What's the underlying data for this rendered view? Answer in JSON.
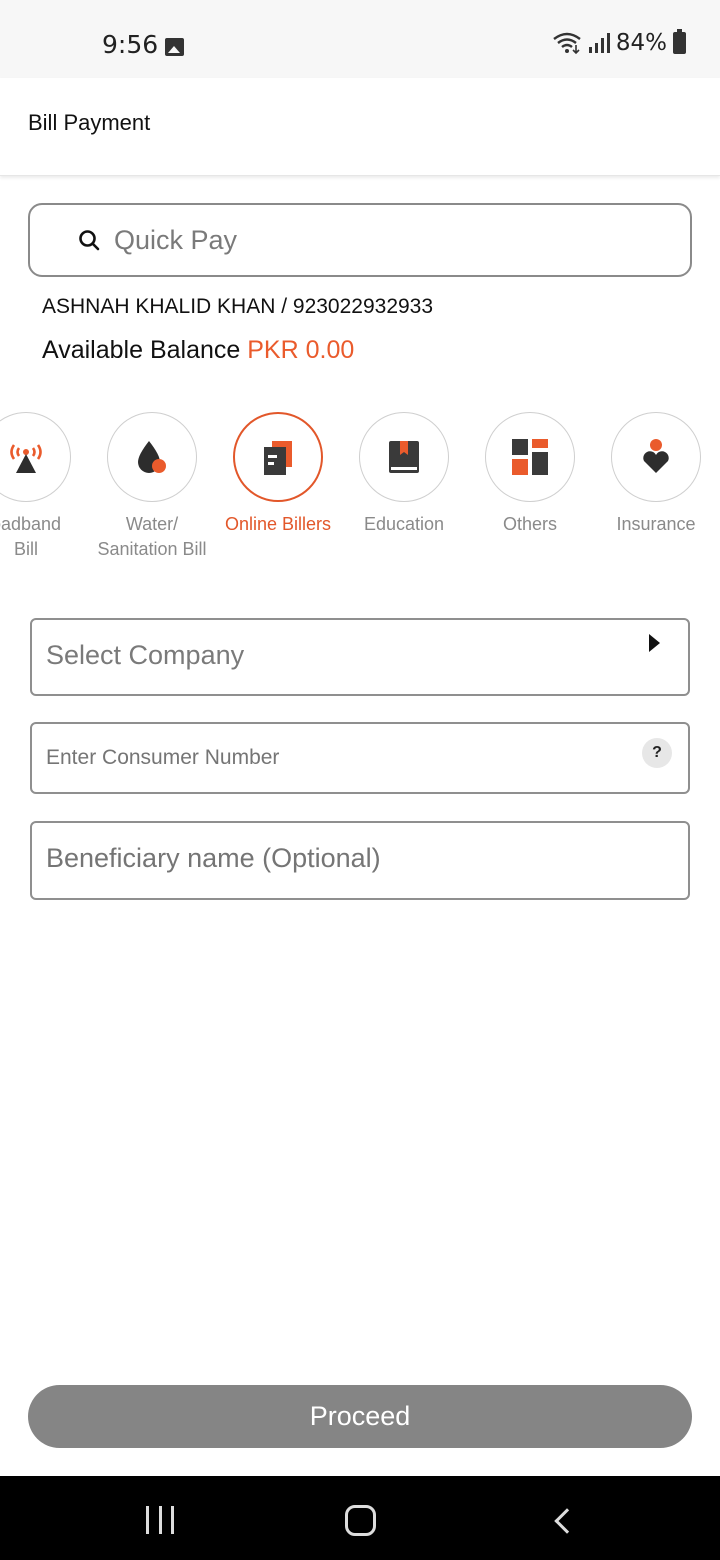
{
  "status_bar": {
    "time": "9:56",
    "battery": "84%",
    "icons": [
      "image-notification-icon",
      "wifi-icon",
      "signal-icon",
      "battery-icon"
    ]
  },
  "header": {
    "title": "Bill Payment"
  },
  "quick_pay": {
    "placeholder": "Quick Pay",
    "icon": "search-icon"
  },
  "account": {
    "name_and_number": "ASHNAH KHALID KHAN / 923022932933",
    "balance_label": "Available Balance",
    "balance_amount": "PKR 0.00"
  },
  "categories": [
    {
      "label_line1": "oadband",
      "label_line2": "Bill",
      "icon": "broadband-tower-icon",
      "active": false
    },
    {
      "label_line1": "Water/",
      "label_line2": "Sanitation Bill",
      "icon": "water-drop-icon",
      "active": false
    },
    {
      "label_line1": "Online Billers",
      "label_line2": "",
      "icon": "online-billers-icon",
      "active": true
    },
    {
      "label_line1": "Education",
      "label_line2": "",
      "icon": "book-icon",
      "active": false
    },
    {
      "label_line1": "Others",
      "label_line2": "",
      "icon": "grid-icon",
      "active": false
    },
    {
      "label_line1": "Insurance",
      "label_line2": "",
      "icon": "insurance-person-heart-icon",
      "active": false
    }
  ],
  "form": {
    "company_select": "Select Company",
    "consumer_placeholder": "Enter Consumer Number",
    "help_symbol": "?",
    "beneficiary_placeholder": "Beneficiary name (Optional)"
  },
  "proceed_label": "Proceed",
  "colors": {
    "accent": "#ea5b2c",
    "dark_icon": "#3a3a3a",
    "disabled_button": "#858585"
  }
}
